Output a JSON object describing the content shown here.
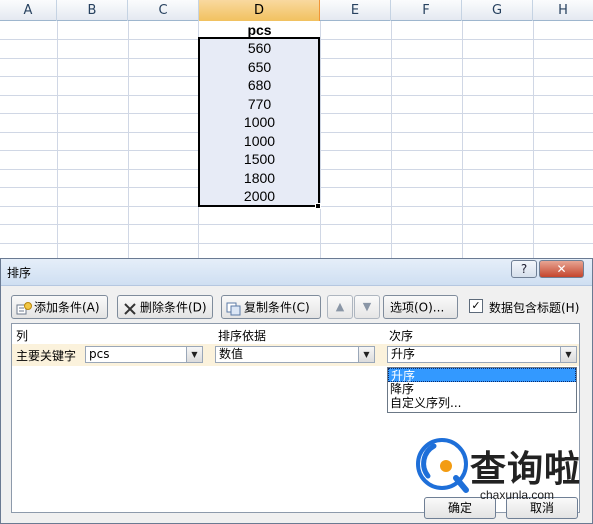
{
  "spreadsheet": {
    "columns": [
      "A",
      "B",
      "C",
      "D",
      "E",
      "F",
      "G",
      "H"
    ],
    "active_column": "D",
    "header_cell": "pcs",
    "values": [
      "560",
      "650",
      "680",
      "770",
      "1000",
      "1000",
      "1500",
      "1800",
      "2000"
    ]
  },
  "dialog": {
    "title": "排序",
    "help_label": "?",
    "close_label": "✕",
    "toolbar": {
      "add_label": "添加条件(A)",
      "delete_label": "删除条件(D)",
      "copy_label": "复制条件(C)",
      "up_label": "▲",
      "down_label": "▼",
      "options_label": "选项(O)...",
      "header_checkbox_label": "数据包含标题(H)",
      "header_checkbox_checked": "✓"
    },
    "list": {
      "col_header": "列",
      "sort_on_header": "排序依据",
      "order_header": "次序",
      "row": {
        "label": "主要关键字",
        "column_value": "pcs",
        "sort_on_value": "数值",
        "order_value": "升序"
      },
      "order_options": [
        "升序",
        "降序",
        "自定义序列..."
      ],
      "highlighted_option": "升序"
    },
    "ok_label": "确定",
    "cancel_label": "取消"
  },
  "watermark": {
    "text": "查询啦",
    "url": "chaxunla.com"
  },
  "colors": {
    "selection_fill": "#e7ebf6",
    "active_column_header": "#f1c15f",
    "dropdown_highlight": "#3399ff",
    "close_button": "#c4452d",
    "watermark_blue": "#1e6fd9",
    "watermark_orange": "#f39c12"
  }
}
